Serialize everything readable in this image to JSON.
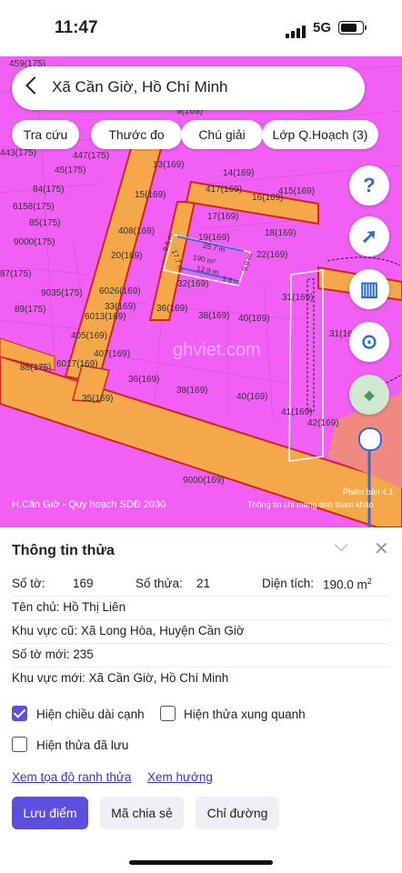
{
  "status": {
    "time": "11:47",
    "network": "5G"
  },
  "search": {
    "query": "Xã Cần Giờ, Hồ Chí Minh"
  },
  "chips": [
    "Tra cứu",
    "Thước đo",
    "Chú giải",
    "Lớp Q.Hoạch (3)"
  ],
  "fabs": {
    "help": "?",
    "compass": "➚",
    "barcode": "▥",
    "locate": "⊙"
  },
  "map": {
    "parcels": [
      "459(175)",
      "9(169)",
      "443(175)",
      "447(175)",
      "13(169)",
      "14(169)",
      "45(175)",
      "84(175)",
      "15(169)",
      "417(169)",
      "415(169)",
      "16(169)",
      "6158(175)",
      "17(169)",
      "85(175)",
      "408(169)",
      "9000(175)",
      "19(169)",
      "18(169)",
      "20(169)",
      "22(169)",
      "87(175)",
      "9035(175)",
      "6026(169)",
      "32(169)",
      "31(169)",
      "89(175)",
      "33(169)",
      "6013(169)",
      "36(169)",
      "38(169)",
      "40(169)",
      "405(169)",
      "407(169)",
      "6017(169)",
      "36(169)",
      "88(175)",
      "38(169)",
      "35(169)",
      "40(169)",
      "41(169)",
      "42(169)",
      "9000(169)",
      "31(169)"
    ],
    "dimensions": {
      "d1": "25.7 m",
      "d2": "190 m²",
      "d3": "12.9 m",
      "d4": "3.8 m",
      "d5": "17.7 m",
      "d6": "8.5 m",
      "d7": "9.9 m"
    },
    "watermark": "ghviet.com",
    "attribution_left": "H.Cần Giờ - Quy hoạch SDĐ 2030",
    "attribution_right": "Thông tin chỉ mang tính tham khảo",
    "version": "Phiên bản 4.1",
    "colors": {
      "land": "#f25ff5",
      "road": "#f5a84a",
      "road_edge": "#d0281a"
    }
  },
  "panel": {
    "title": "Thông tin thửa",
    "so_to_label": "Số tờ:",
    "so_to": "169",
    "so_thua_label": "Số thửa:",
    "so_thua": "21",
    "dien_tich_label": "Diện tích:",
    "dien_tich": "190.0 m",
    "dien_tich_sup": "2",
    "ten_chu": "Tên chủ:  Hồ Thị Liên",
    "khu_vuc_cu": "Khu vực cũ: Xã Long Hòa, Huyện Cần Giờ",
    "so_to_moi": "Số tờ mới: 235",
    "khu_vuc_moi": "Khu vực mới: Xã Cần Giờ, Hồ Chí Minh",
    "cb1": "Hiện chiều dài cạnh",
    "cb1_checked": true,
    "cb2": "Hiện thửa xung quanh",
    "cb2_checked": false,
    "cb3": "Hiện thửa đã lưu",
    "cb3_checked": false,
    "link1": "Xem tọa độ ranh thửa",
    "link2": "Xem hướng",
    "btn_save": "Lưu điểm",
    "btn_share": "Mã chia sẻ",
    "btn_route": "Chỉ đường",
    "accent": "#5b4fe0"
  }
}
